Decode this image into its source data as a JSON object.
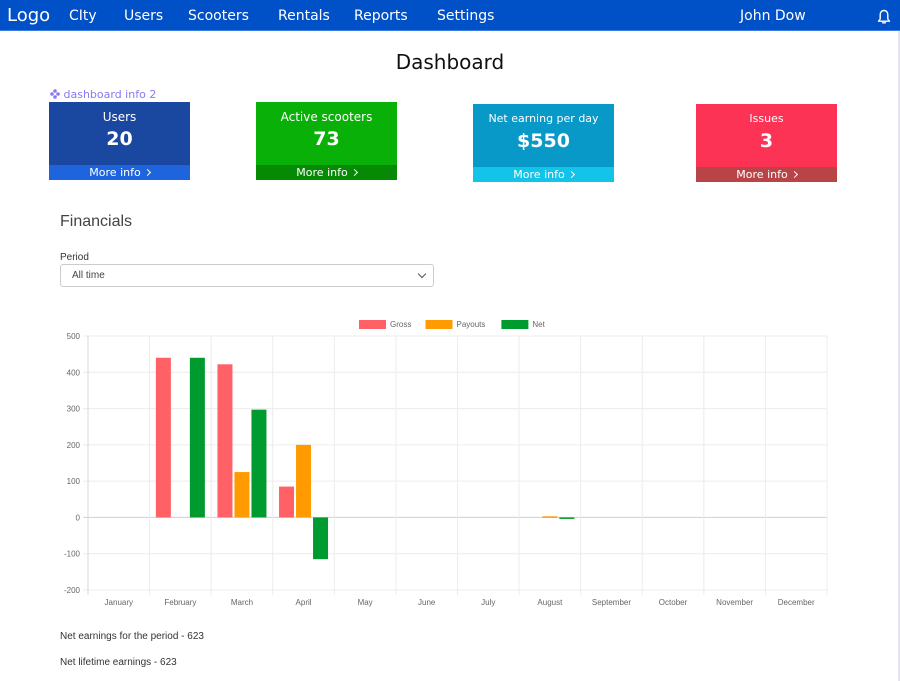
{
  "navbar": {
    "logo": "Logo",
    "items": [
      {
        "label": "CIty"
      },
      {
        "label": "Users"
      },
      {
        "label": "Scooters"
      },
      {
        "label": "Rentals"
      },
      {
        "label": "Reports"
      },
      {
        "label": "Settings"
      }
    ],
    "user_name": "John Dow",
    "bell_icon": "bell-icon"
  },
  "page": {
    "title": "Dashboard",
    "info_link": "dashboard info 2",
    "info_icon": "diamond-dots-icon"
  },
  "cards": [
    {
      "label": "Users",
      "value": "20",
      "more": "More info",
      "color": "#1a48a0",
      "footer_color": "#1e64dc"
    },
    {
      "label": "Active scooters",
      "value": "73",
      "more": "More info",
      "color": "#08b008",
      "footer_color": "#068a06"
    },
    {
      "label": "Net earning per day",
      "value": "$550",
      "more": "More info",
      "color": "#0899c9",
      "footer_color": "#12c3ea"
    },
    {
      "label": "Issues",
      "value": "3",
      "more": "More info",
      "color": "#fc3355",
      "footer_color": "#b94448"
    }
  ],
  "financials": {
    "title": "Financials",
    "period_label": "Period",
    "period_value": "All time",
    "net_period": "Net earnings for the period - 623",
    "net_lifetime": "Net lifetime earnings - 623"
  },
  "chart_data": {
    "type": "bar",
    "title": "",
    "xlabel": "",
    "ylabel": "",
    "categories": [
      "January",
      "February",
      "March",
      "April",
      "May",
      "June",
      "July",
      "August",
      "September",
      "October",
      "November",
      "December"
    ],
    "series": [
      {
        "name": "Gross",
        "color": "#ff6166",
        "values": [
          0,
          440,
          422,
          85,
          0,
          0,
          0,
          0,
          0,
          0,
          0,
          0
        ]
      },
      {
        "name": "Payouts",
        "color": "#ff9a00",
        "values": [
          0,
          0,
          125,
          200,
          0,
          0,
          0,
          3,
          0,
          0,
          0,
          0
        ]
      },
      {
        "name": "Net",
        "color": "#009b2e",
        "values": [
          0,
          440,
          297,
          -115,
          0,
          0,
          0,
          -3,
          0,
          0,
          0,
          0
        ]
      }
    ],
    "ylim": [
      -200,
      500
    ],
    "yticks": [
      500,
      400,
      300,
      200,
      100,
      0,
      -100,
      -200
    ],
    "grid": true,
    "legend": "top-center"
  }
}
